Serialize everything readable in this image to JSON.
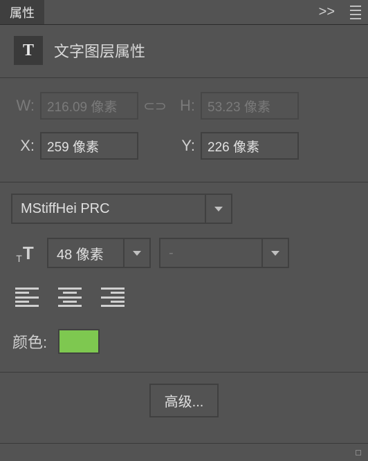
{
  "panel": {
    "tab_title": "属性",
    "expand_glyph": ">>",
    "section_icon_text": "T",
    "section_title": "文字图层属性"
  },
  "dimensions": {
    "w_label": "W:",
    "w_value": "216.09 像素",
    "h_label": "H:",
    "h_value": "53.23 像素",
    "x_label": "X:",
    "x_value": "259 像素",
    "y_label": "Y:",
    "y_value": "226 像素",
    "link_glyph": "⊂⊃"
  },
  "font": {
    "family": "MStiffHei PRC",
    "size": "48 像素",
    "weight": "-"
  },
  "color": {
    "label": "颜色:",
    "hex": "#7ec850"
  },
  "buttons": {
    "advanced": "高级..."
  }
}
